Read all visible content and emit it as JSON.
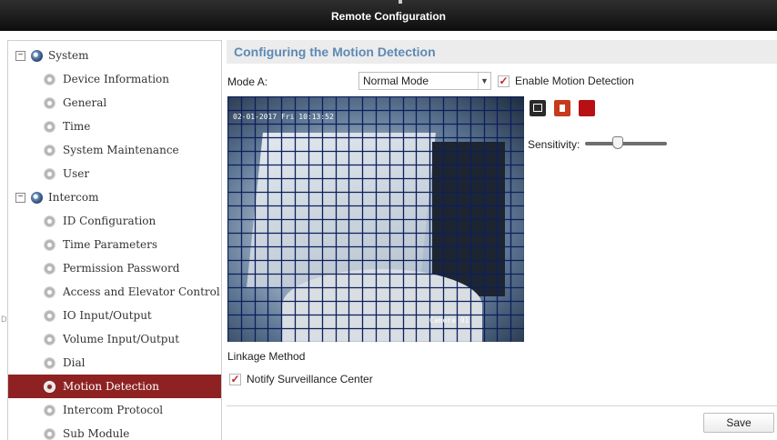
{
  "window": {
    "title": "Remote Configuration"
  },
  "sidebar": {
    "groups": [
      {
        "label": "System",
        "toggle": "−",
        "items": [
          {
            "label": "Device Information"
          },
          {
            "label": "General"
          },
          {
            "label": "Time"
          },
          {
            "label": "System Maintenance"
          },
          {
            "label": "User"
          }
        ]
      },
      {
        "label": "Intercom",
        "toggle": "−",
        "items": [
          {
            "label": "ID Configuration"
          },
          {
            "label": "Time Parameters"
          },
          {
            "label": "Permission Password"
          },
          {
            "label": "Access and Elevator Control"
          },
          {
            "label": "IO Input/Output"
          },
          {
            "label": "Volume Input/Output"
          },
          {
            "label": "Dial"
          },
          {
            "label": "Motion Detection",
            "active": true
          },
          {
            "label": "Intercom Protocol"
          },
          {
            "label": "Sub Module"
          }
        ]
      }
    ],
    "edge_marker": "D"
  },
  "main": {
    "section_title": "Configuring the Motion Detection",
    "mode_label": "Mode A:",
    "mode_value": "Normal Mode",
    "enable_motion_label": "Enable Motion Detection",
    "enable_motion_checked": true,
    "video": {
      "osd_time": "02-01-2017 Fri 10:13:52",
      "osd_camera": "Camera 01",
      "grid_color": "#0d1f5c"
    },
    "tools": {
      "draw_icon": "draw-area-icon",
      "clear_icon": "delete-icon",
      "all_icon": "select-all-icon"
    },
    "sensitivity_label": "Sensitivity:",
    "sensitivity_level": 0.4,
    "linkage_label": "Linkage Method",
    "notify_label": "Notify Surveillance Center",
    "notify_checked": true,
    "save_label": "Save",
    "accent_color": "#8e2222",
    "title_color": "#5e8ab5"
  }
}
